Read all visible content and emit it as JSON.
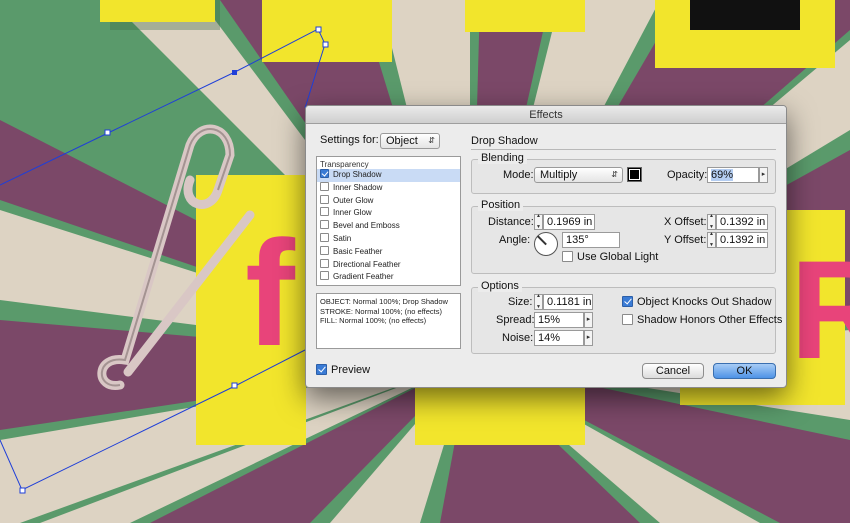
{
  "dialog": {
    "title": "Effects",
    "settings_for_label": "Settings for:",
    "settings_for_value": "Object",
    "section_title": "Drop Shadow",
    "effects_list": {
      "header": "Transparency",
      "items": [
        {
          "label": "Drop Shadow",
          "checked": true,
          "selected": true
        },
        {
          "label": "Inner Shadow",
          "checked": false,
          "selected": false
        },
        {
          "label": "Outer Glow",
          "checked": false,
          "selected": false
        },
        {
          "label": "Inner Glow",
          "checked": false,
          "selected": false
        },
        {
          "label": "Bevel and Emboss",
          "checked": false,
          "selected": false
        },
        {
          "label": "Satin",
          "checked": false,
          "selected": false
        },
        {
          "label": "Basic Feather",
          "checked": false,
          "selected": false
        },
        {
          "label": "Directional Feather",
          "checked": false,
          "selected": false
        },
        {
          "label": "Gradient Feather",
          "checked": false,
          "selected": false
        }
      ]
    },
    "summary": [
      "OBJECT: Normal 100%; Drop Shadow",
      "STROKE: Normal 100%; (no effects)",
      "FILL: Normal 100%; (no effects)"
    ],
    "blending": {
      "label": "Blending",
      "mode_label": "Mode:",
      "mode_value": "Multiply",
      "shadow_color": "#000000",
      "opacity_label": "Opacity:",
      "opacity_value": "69%"
    },
    "position": {
      "label": "Position",
      "distance_label": "Distance:",
      "distance_value": "0.1969 in",
      "angle_label": "Angle:",
      "angle_value": "135°",
      "x_offset_label": "X Offset:",
      "x_offset_value": "0.1392 in",
      "y_offset_label": "Y Offset:",
      "y_offset_value": "0.1392 in",
      "use_global_light_label": "Use Global Light",
      "use_global_light": false
    },
    "options": {
      "label": "Options",
      "size_label": "Size:",
      "size_value": "0.1181 in",
      "spread_label": "Spread:",
      "spread_value": "15%",
      "noise_label": "Noise:",
      "noise_value": "14%",
      "knocks_out_label": "Object Knocks Out Shadow",
      "knocks_out": true,
      "honors_effects_label": "Shadow Honors Other Effects",
      "honors_effects": false
    },
    "preview_label": "Preview",
    "preview": true,
    "cancel_label": "Cancel",
    "ok_label": "OK"
  },
  "canvas": {
    "letters": [
      "f",
      "R"
    ],
    "colors": {
      "background_green": "#5a9a6b",
      "purple": "#7b4868",
      "beige": "#ddd3c3",
      "yellow": "#f2e52c",
      "pink": "#e8447a",
      "path_blue": "#1f3fd8"
    }
  }
}
